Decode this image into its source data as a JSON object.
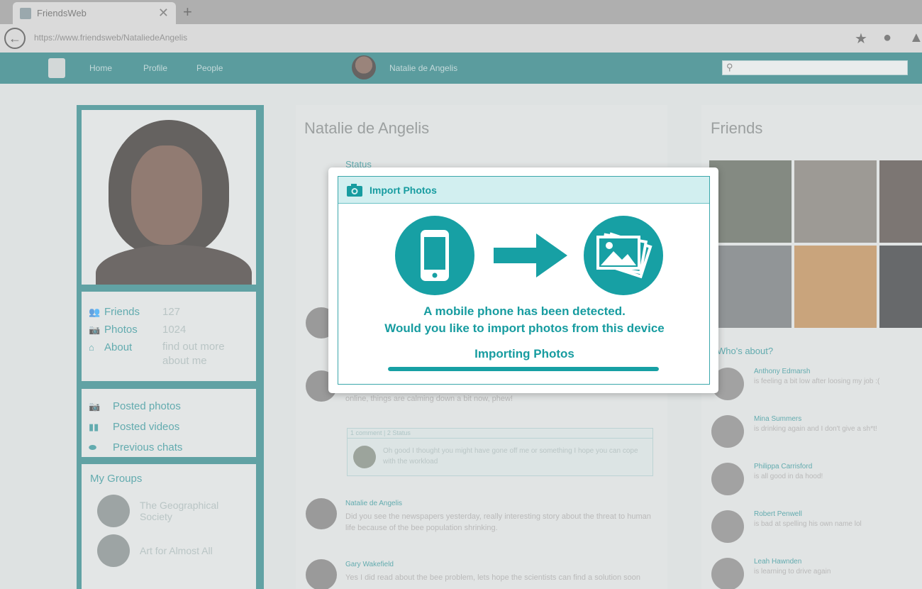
{
  "browser": {
    "tab_title": "FriendsWeb",
    "tab_close": "✕",
    "new_tab": "+",
    "url": "https://www.friendsweb/NataliedeAngelis"
  },
  "nav": {
    "links": [
      "Home",
      "Profile",
      "People"
    ],
    "user_name": "Natalie de Angelis"
  },
  "profile": {
    "stats": [
      {
        "label": "Friends",
        "value": "127",
        "icon": "friends-icon"
      },
      {
        "label": "Photos",
        "value": "1024",
        "icon": "camera-icon"
      },
      {
        "label": "About",
        "value": "find out more about me",
        "icon": "home-icon"
      }
    ],
    "links": [
      {
        "label": "Posted photos",
        "icon": "camera-icon"
      },
      {
        "label": "Posted videos",
        "icon": "video-icon"
      },
      {
        "label": "Previous chats",
        "icon": "chat-icon"
      }
    ],
    "groups_title": "My Groups",
    "groups": [
      "The Geographical Society",
      "Art for Almost All"
    ]
  },
  "feed": {
    "title": "Natalie de Angelis",
    "status_label": "Status",
    "posts": [
      {
        "name": "",
        "text": "online, things are calming down a bit now, phew!"
      },
      {
        "name": "Natalie de Angelis",
        "text": "Did you see the newspapers yesterday, really interesting story about the threat to human life because of the bee population shrinking."
      },
      {
        "name": "Gary Wakefield",
        "text": "Yes I did read about the bee problem, lets hope the scientists can find a solution soon"
      }
    ],
    "comment": {
      "bar": "1 comment | 2 Status",
      "text": "Oh good I thought you might have gone off me or something I hope you can cope with the workload"
    }
  },
  "friends": {
    "title": "Friends",
    "whos_about": "Who's about?",
    "people": [
      {
        "name": "Anthony Edmarsh",
        "status": "is feeling a bit low after loosing my job :("
      },
      {
        "name": "Mina Summers",
        "status": "is drinking again and I don't give a sh*t!"
      },
      {
        "name": "Philippa Carrisford",
        "status": "is all good in da hood!"
      },
      {
        "name": "Robert Penwell",
        "status": "is bad at spelling his own name lol"
      },
      {
        "name": "Leah Hawnden",
        "status": "is learning to drive again"
      }
    ]
  },
  "dialog": {
    "title": "Import Photos",
    "message_line1": "A mobile phone has been detected.",
    "message_line2": "Would you like to import photos from this device",
    "progress_label": "Importing Photos",
    "progress": 1.0,
    "accent": "#17a0a4"
  },
  "colors": {
    "nav_bg": "#0e6d70",
    "accent": "#198489"
  }
}
